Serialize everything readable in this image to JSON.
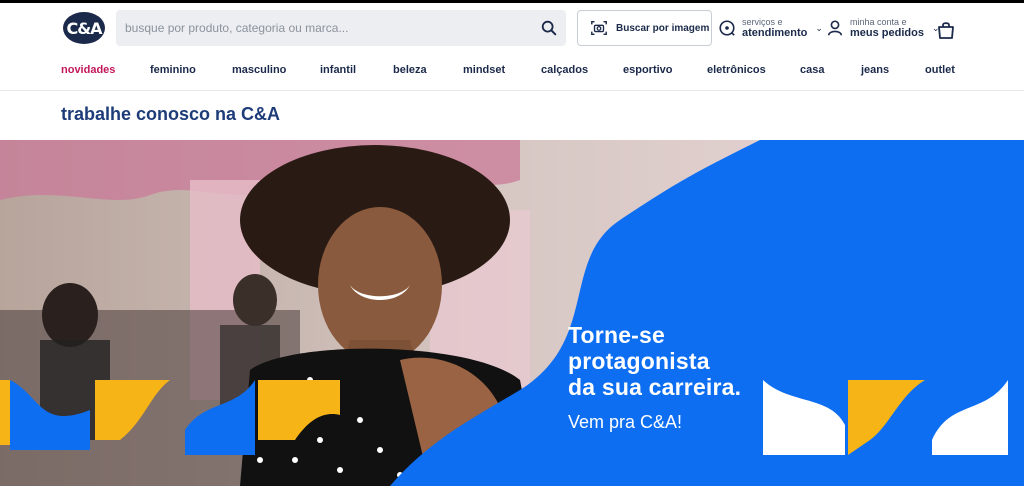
{
  "header": {
    "logo_text": "C&A",
    "search_placeholder": "busque por produto, categoria ou marca...",
    "image_search_label": "Buscar por imagem",
    "services_small": "serviços e",
    "services_big": "atendimento",
    "account_small": "minha conta e",
    "account_big": "meus pedidos"
  },
  "nav": {
    "items": [
      {
        "label": "novidades"
      },
      {
        "label": "feminino"
      },
      {
        "label": "masculino"
      },
      {
        "label": "infantil"
      },
      {
        "label": "beleza"
      },
      {
        "label": "mindset"
      },
      {
        "label": "calçados"
      },
      {
        "label": "esportivo"
      },
      {
        "label": "eletrônicos"
      },
      {
        "label": "casa"
      },
      {
        "label": "jeans"
      },
      {
        "label": "outlet"
      }
    ]
  },
  "page": {
    "title": "trabalhe conosco na C&A"
  },
  "hero": {
    "headline_1": "Torne-se",
    "headline_2": "protagonista",
    "headline_3": "da sua carreira.",
    "subline": "Vem pra C&A!"
  },
  "colors": {
    "brand_blue": "#0d6ef2",
    "accent_yellow": "#f6b417",
    "highlight_pink": "#c2185b",
    "text_navy": "#1b2a4a"
  },
  "icons": {
    "search": "search-icon",
    "camera": "camera-icon",
    "support": "support-icon",
    "user": "user-icon",
    "bag": "shopping-bag-icon"
  }
}
